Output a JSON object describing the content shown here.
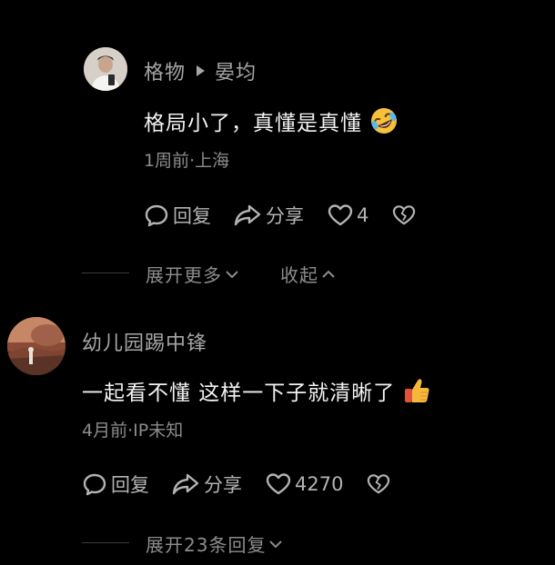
{
  "reply": {
    "author": "格物",
    "reply_to": "晏均",
    "text": "格局小了，真懂是真懂",
    "emoji": "rolling-on-floor-laughing",
    "meta": "1周前·上海",
    "reply_label": "回复",
    "share_label": "分享",
    "like_count": "4"
  },
  "collapse_bar": {
    "expand_more": "展开更多",
    "collapse": "收起"
  },
  "comment": {
    "author": "幼儿园踢中锋",
    "text": "一起看不懂 这样一下子就清晰了",
    "emoji": "thumbs-up",
    "meta": "4月前·IP未知",
    "reply_label": "回复",
    "share_label": "分享",
    "like_count": "4270"
  },
  "replies_bar": {
    "expand_replies": "展开23条回复"
  },
  "colors": {
    "background": "#000000",
    "primary_text": "#f2f2f2",
    "secondary_text": "#a6a6a6",
    "muted_text": "#8c8c8c"
  }
}
